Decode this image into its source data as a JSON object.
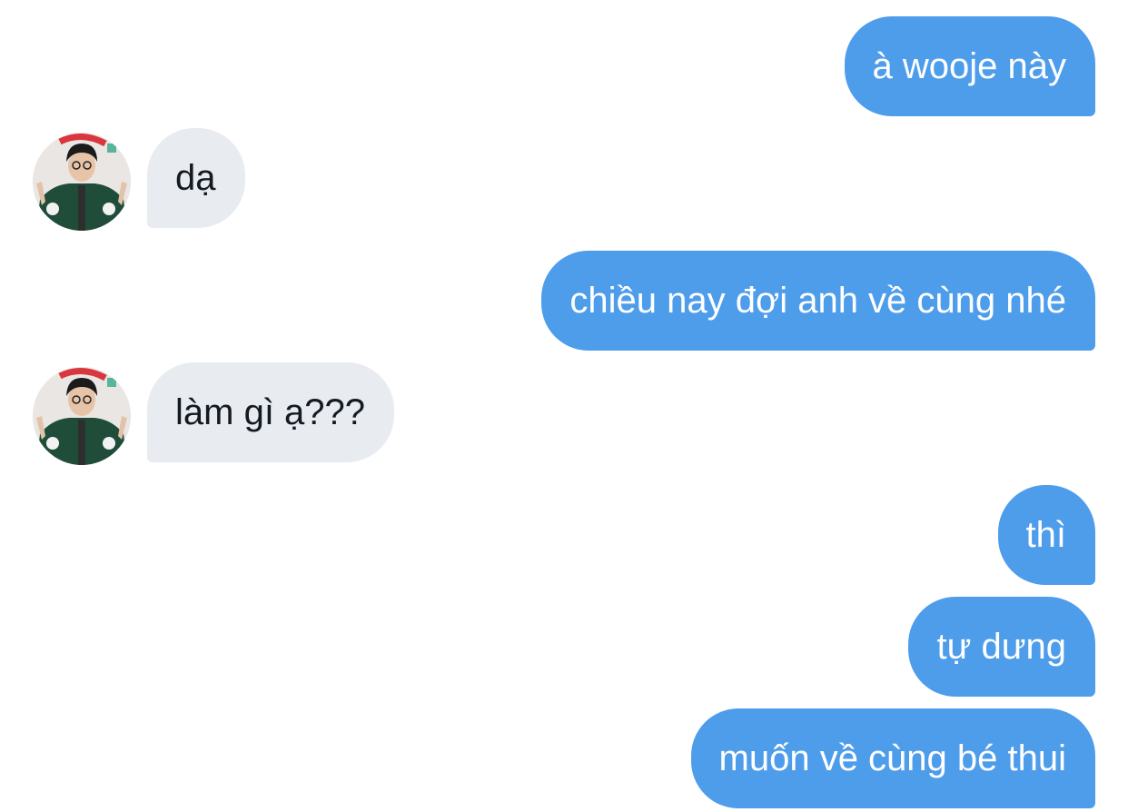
{
  "messages": [
    {
      "direction": "outgoing",
      "text": "à wooje này"
    },
    {
      "direction": "incoming",
      "text": "dạ",
      "avatar_icon": "contact-avatar"
    },
    {
      "direction": "outgoing",
      "text": "chiều nay đợi anh về cùng nhé"
    },
    {
      "direction": "incoming",
      "text": "làm gì ạ???",
      "avatar_icon": "contact-avatar"
    },
    {
      "direction": "outgoing",
      "text": "thì"
    },
    {
      "direction": "outgoing",
      "text": "tự dưng"
    },
    {
      "direction": "outgoing",
      "text": "muốn về cùng bé thui"
    }
  ],
  "colors": {
    "outgoing_bubble": "#4e9deb",
    "incoming_bubble": "#e8ebf0",
    "outgoing_text": "#ffffff",
    "incoming_text": "#141a22"
  }
}
